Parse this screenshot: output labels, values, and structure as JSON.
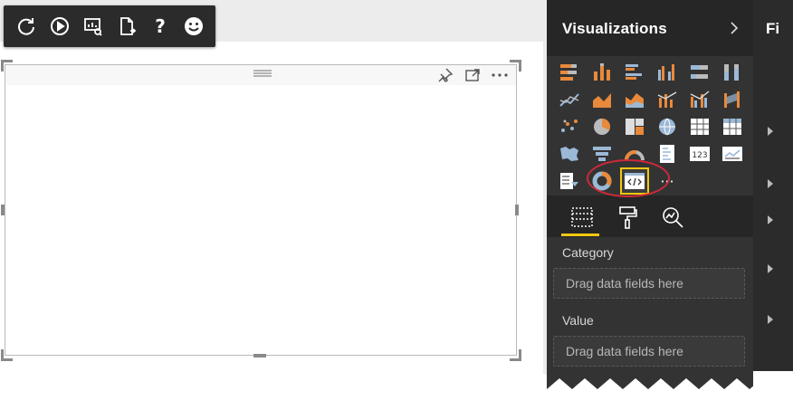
{
  "toolbar": {
    "buttons": [
      {
        "name": "refresh-icon"
      },
      {
        "name": "play-icon"
      },
      {
        "name": "report-view-icon"
      },
      {
        "name": "page-export-icon"
      },
      {
        "name": "help-icon"
      },
      {
        "name": "smiley-feedback-icon"
      }
    ]
  },
  "visual": {
    "header_icons": [
      "pin-icon",
      "focus-mode-icon",
      "more-options-icon"
    ]
  },
  "visualizations_panel": {
    "title": "Visualizations",
    "more_glyph": "···",
    "tabs": [
      "fields-tab-icon",
      "format-paint-roller-icon",
      "analytics-magnifier-icon"
    ],
    "wells": [
      {
        "label": "Category",
        "placeholder": "Drag data fields here"
      },
      {
        "label": "Value",
        "placeholder": "Drag data fields here"
      }
    ],
    "selected_visual": "custom-visual-code-icon",
    "card_text": "123"
  },
  "filters_panel": {
    "title": "Fi"
  },
  "colors": {
    "panel_bg": "#333333",
    "accent_yellow": "#f2c811",
    "highlight_red": "#cc2a3a",
    "bar_orange": "#e8893b",
    "bar_blue": "#9bb8d6"
  }
}
